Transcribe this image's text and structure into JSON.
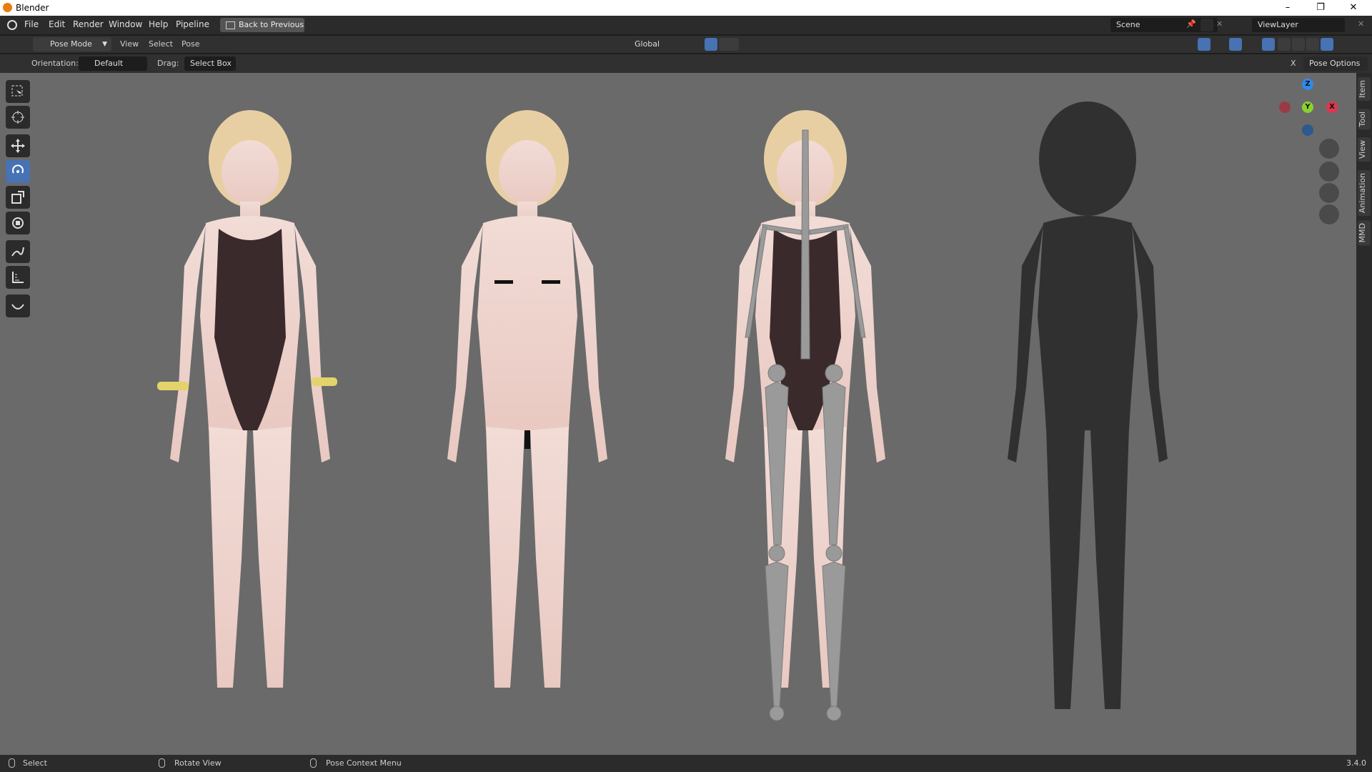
{
  "window": {
    "title": "Blender"
  },
  "menu": {
    "items": [
      "File",
      "Edit",
      "Render",
      "Window",
      "Help",
      "Pipeline"
    ],
    "back_button": "Back to Previous"
  },
  "scene": {
    "name": "Scene",
    "view_layer": "ViewLayer"
  },
  "header": {
    "mode": "Pose Mode",
    "menus": [
      "View",
      "Select",
      "Pose"
    ],
    "transform_orientation": "Global"
  },
  "tool_settings": {
    "orientation_label": "Orientation:",
    "orientation_value": "Default",
    "drag_label": "Drag:",
    "drag_value": "Select Box",
    "pose_options": "Pose Options"
  },
  "toolbar": {
    "tools": [
      "select-box",
      "cursor",
      "move",
      "rotate",
      "scale",
      "transform",
      "annotate",
      "measure",
      "relax"
    ],
    "active_tool": "rotate"
  },
  "gizmo": {
    "axes": [
      "Z",
      "Y",
      "X"
    ]
  },
  "sidebar": {
    "tabs": [
      "Item",
      "Tool",
      "View",
      "Animation",
      "MMD"
    ]
  },
  "status": {
    "left_action": "Select",
    "middle_action": "Rotate View",
    "right_action": "Pose Context Menu",
    "version": "3.4.0"
  },
  "colors": {
    "accent": "#4772b3",
    "viewport_bg": "#6a6a6a",
    "axis_x": "#e0364f",
    "axis_y": "#8bd12c",
    "axis_z": "#2d8ceb"
  }
}
